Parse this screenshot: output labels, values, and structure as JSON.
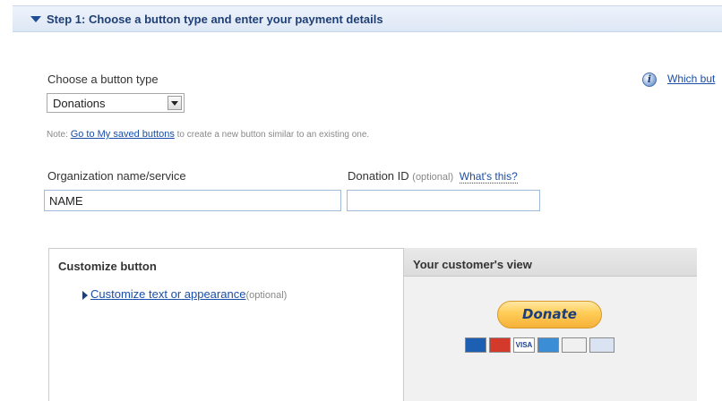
{
  "step": {
    "title": "Step 1: Choose a button type and enter your payment details"
  },
  "button_type": {
    "label": "Choose a button type",
    "selected": "Donations"
  },
  "help": {
    "link_text": "Which but"
  },
  "note": {
    "prefix": "Note: ",
    "link": "Go to My saved buttons",
    "suffix": " to create a new button similar to an existing one."
  },
  "org": {
    "label": "Organization name/service",
    "value": "NAME"
  },
  "donation_id": {
    "label": "Donation ID",
    "optional": "(optional)",
    "whats_this": "What's this?",
    "value": ""
  },
  "customize": {
    "title": "Customize button",
    "link": "Customize text or appearance",
    "optional": "(optional)"
  },
  "preview": {
    "title": "Your customer's view",
    "button_label": "Donate",
    "cards": [
      "maestro",
      "mastercard",
      "visa",
      "amex",
      "discover",
      "bank"
    ]
  }
}
